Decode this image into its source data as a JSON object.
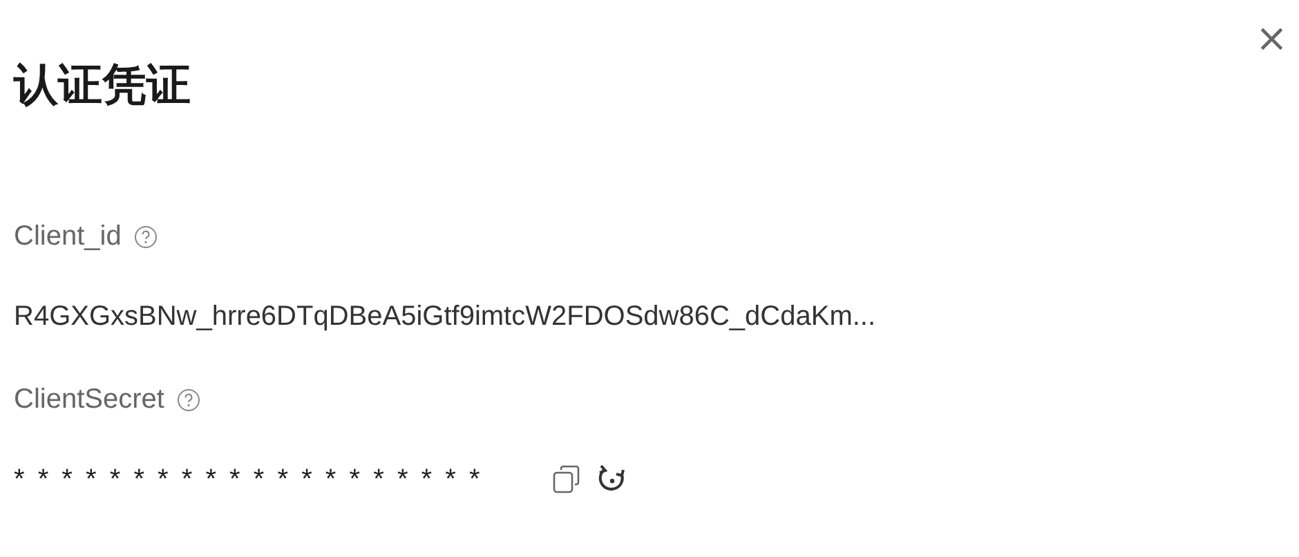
{
  "dialog": {
    "title": "认证凭证",
    "close": "×"
  },
  "fields": [
    {
      "label": "Client_id",
      "value": "R4GXGxsBNw_hrre6DTqDBeA5iGtf9imtcW2FDOSdw86C_dCdaKm...",
      "kind": "text"
    },
    {
      "label": "ClientSecret",
      "value": "* * * * * * * * * * * * * * * * * * * *",
      "kind": "secret"
    }
  ]
}
